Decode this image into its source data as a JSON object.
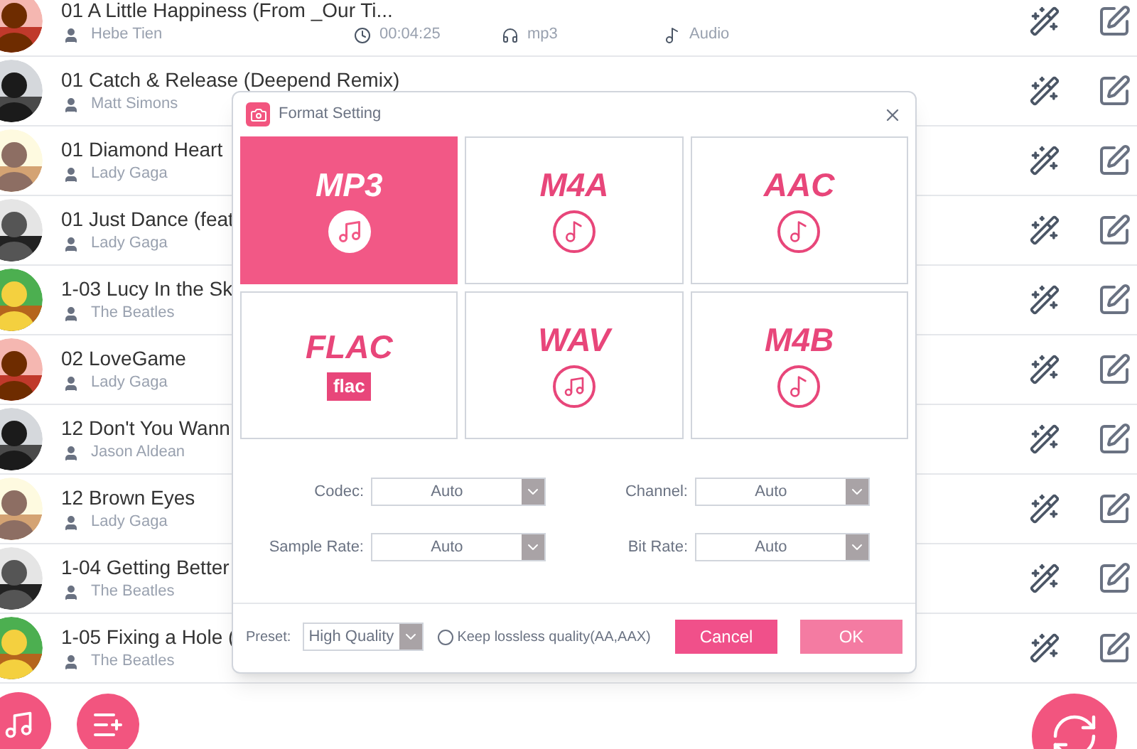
{
  "songs": [
    {
      "title": "01 A Little Happiness (From _Our Ti...",
      "artist": "Hebe Tien",
      "duration": "00:04:25",
      "format": "mp3",
      "type": "Audio"
    },
    {
      "title": "01 Catch & Release (Deepend Remix)",
      "artist": "Matt Simons"
    },
    {
      "title": "01 Diamond Heart",
      "artist": "Lady Gaga"
    },
    {
      "title": "01 Just Dance (feat",
      "artist": "Lady Gaga"
    },
    {
      "title": "1-03 Lucy In the Sk",
      "artist": "The Beatles"
    },
    {
      "title": "02 LoveGame",
      "artist": "Lady Gaga"
    },
    {
      "title": "12 Don't You Wann",
      "artist": "Jason Aldean"
    },
    {
      "title": "12 Brown Eyes",
      "artist": "Lady Gaga"
    },
    {
      "title": "1-04 Getting Better",
      "artist": "The Beatles"
    },
    {
      "title": "1-05 Fixing a Hole (",
      "artist": "The Beatles"
    }
  ],
  "dialog": {
    "title": "Format Setting",
    "formats": [
      {
        "label": "MP3",
        "selected": true,
        "kind": "disc-note"
      },
      {
        "label": "M4A",
        "selected": false,
        "kind": "circle-note"
      },
      {
        "label": "AAC",
        "selected": false,
        "kind": "circle-note"
      },
      {
        "label": "FLAC",
        "selected": false,
        "kind": "flac-badge",
        "badge": "flac"
      },
      {
        "label": "WAV",
        "selected": false,
        "kind": "circle-notes"
      },
      {
        "label": "M4B",
        "selected": false,
        "kind": "circle-note"
      }
    ],
    "settings": [
      {
        "label": "Codec:",
        "value": "Auto"
      },
      {
        "label": "Channel:",
        "value": "Auto"
      },
      {
        "label": "Sample Rate:",
        "value": "Auto"
      },
      {
        "label": "Bit Rate:",
        "value": "Auto"
      }
    ],
    "preset": {
      "label": "Preset:",
      "value": "High Quality"
    },
    "keep_lossless": {
      "label": "Keep lossless quality(AA,AAX)",
      "checked": false
    },
    "buttons": [
      {
        "label": "Cancel",
        "kind": "cancel"
      },
      {
        "label": "OK",
        "kind": "ok"
      }
    ]
  }
}
